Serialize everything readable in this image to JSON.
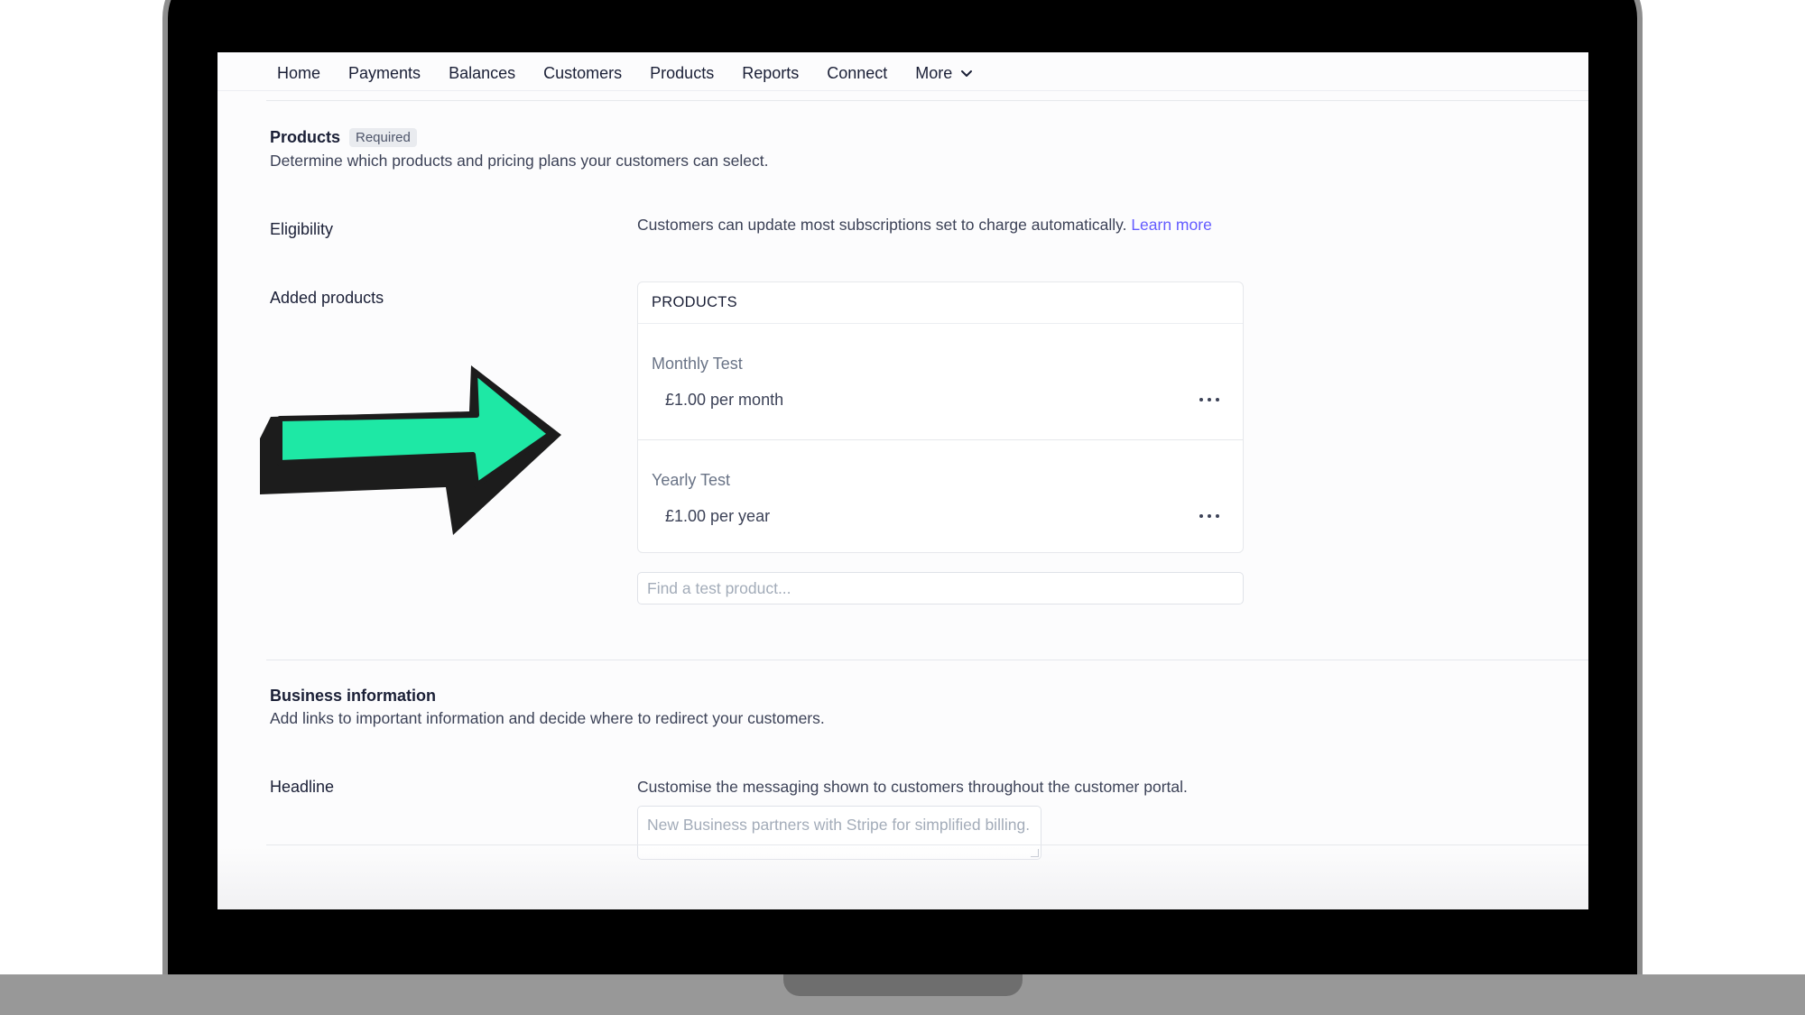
{
  "nav": {
    "items": [
      "Home",
      "Payments",
      "Balances",
      "Customers",
      "Products",
      "Reports",
      "Connect"
    ],
    "more_label": "More"
  },
  "products_section": {
    "title": "Products",
    "badge": "Required",
    "description": "Determine which products and pricing plans your customers can select."
  },
  "eligibility": {
    "label": "Eligibility",
    "text": "Customers can update most subscriptions set to charge automatically.",
    "link": "Learn more"
  },
  "added_products": {
    "label": "Added products",
    "table_header": "PRODUCTS",
    "items": [
      {
        "name": "Monthly Test",
        "price": "£1.00 per month"
      },
      {
        "name": "Yearly Test",
        "price": "£1.00 per year"
      }
    ],
    "search_placeholder": "Find a test product..."
  },
  "business_section": {
    "title": "Business information",
    "description": "Add links to important information and decide where to redirect your customers."
  },
  "headline": {
    "label": "Headline",
    "description": "Customise the messaging shown to customers throughout the customer portal.",
    "placeholder": "New Business partners with Stripe for simplified billing."
  },
  "colors": {
    "accent_link": "#635bff",
    "arrow_fill": "#1ee8a5",
    "arrow_outline": "#1c1c1c"
  },
  "icons": [
    "chevron-down-icon",
    "more-actions-icon",
    "arrow-pointer-graphic"
  ]
}
